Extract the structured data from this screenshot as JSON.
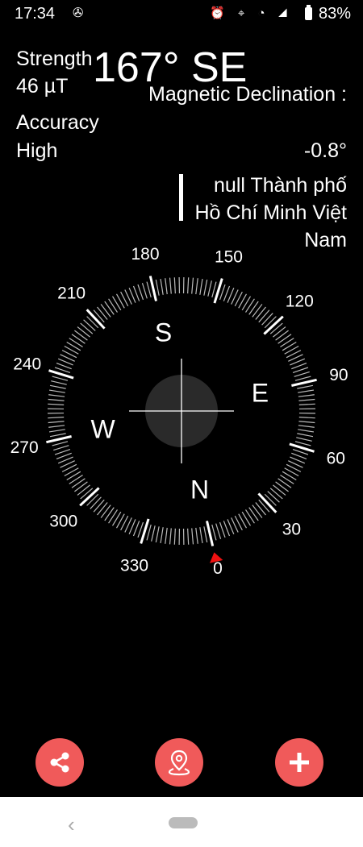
{
  "status_bar": {
    "time": "17:34",
    "left_icons": "✇",
    "right_icons": "⏰ ⌖ ◔ ◢",
    "battery": "83%"
  },
  "heading": "167° SE",
  "strength": {
    "label": "Strength",
    "value": "46 µT"
  },
  "accuracy": {
    "label": "Accuracy",
    "value": "High"
  },
  "declination": {
    "label": "Magnetic Declination :",
    "value": "-0.8°"
  },
  "location": "null Thành phố Hồ Chí Minh Việt Nam",
  "dial": {
    "degree_labels": [
      "0",
      "30",
      "60",
      "90",
      "120",
      "150",
      "180",
      "210",
      "240",
      "270",
      "300",
      "330"
    ],
    "cardinals": {
      "n": "N",
      "e": "E",
      "s": "S",
      "w": "W"
    }
  },
  "actions": {
    "share_icon": "share-icon",
    "location_icon": "map-pin-icon",
    "add_icon": "plus-icon",
    "accent_color": "#f05a5a"
  },
  "nav": {
    "back_symbol": "‹"
  }
}
